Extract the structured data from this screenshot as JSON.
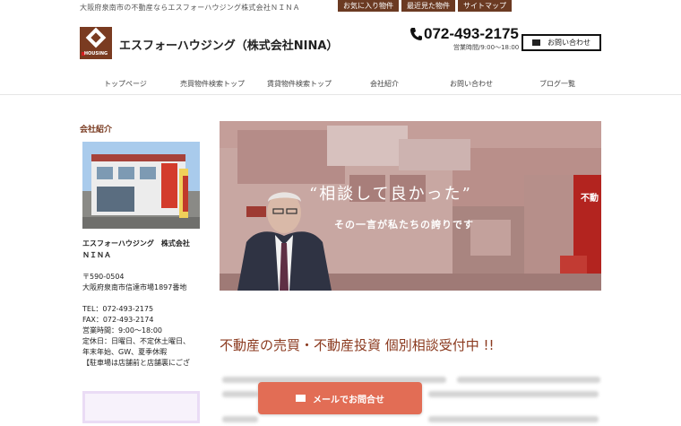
{
  "header": {
    "tagline": "大阪府泉南市の不動産ならエスフォーハウジング株式会社ＮＩＮＡ",
    "top_links": [
      "お気に入り物件",
      "最近見た物件",
      "サイトマップ"
    ],
    "logo_text": "HOUSING",
    "company_name": "エスフォーハウジング（株式会社NINA）",
    "phone": "072-493-2175",
    "hours": "営業時間/9:00～18:00",
    "contact_button": "お問い合わせ"
  },
  "nav": {
    "items": [
      "トップページ",
      "売買物件検索トップ",
      "賃貸物件検索トップ",
      "会社紹介",
      "お問い合わせ",
      "ブログ一覧"
    ]
  },
  "sidebar": {
    "heading": "会社紹介",
    "company_line1": "エスフォーハウジング　株式会社",
    "company_line2": "ＮＩＮＡ",
    "postal": "〒590-0504",
    "address": "大阪府泉南市信達市場1897番地",
    "tel": "TEL：072-493-2175",
    "fax": "FAX：072-493-2174",
    "hours": "営業時間：9:00～18:00",
    "holidays1": "定休日：日曜日、不定休土曜日、",
    "holidays2": "年末年始、GW、夏季休暇",
    "parking": "【駐車場は店舗前と店舗裏にござ"
  },
  "hero": {
    "headline": "“相談して良かった”",
    "subline": "その一言が私たちの誇りです",
    "shop_sign": "不動"
  },
  "main": {
    "consult_heading": "不動産の売買・不動産投資 個別相談受付中 !!",
    "mail_button": "メールでお問合せ"
  }
}
